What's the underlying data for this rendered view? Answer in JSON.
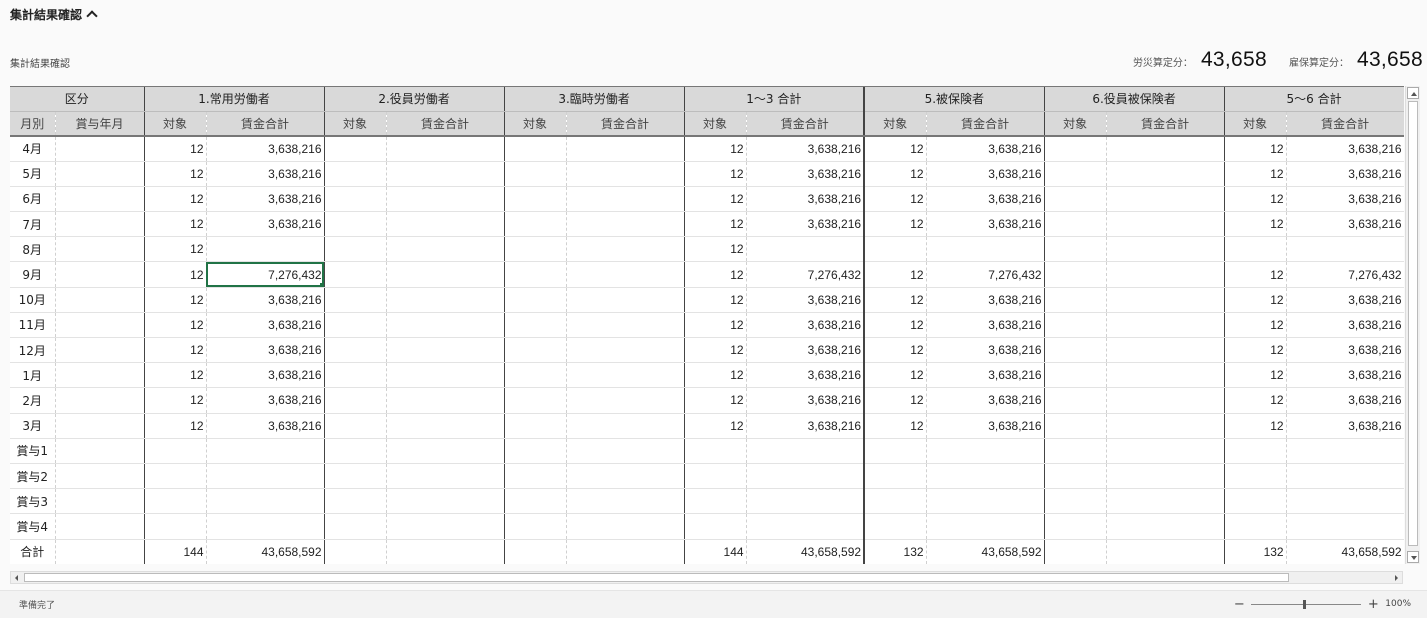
{
  "section": {
    "title": "集計結果確認"
  },
  "sub_title": "集計結果確認",
  "summary": {
    "rousai_label": "労災算定分：",
    "rousai_value": "43,658",
    "koyou_label": "雇保算定分：",
    "koyou_value": "43,658"
  },
  "grid": {
    "groups": [
      "区分",
      "1.常用労働者",
      "2.役員労働者",
      "3.臨時労働者",
      "1〜3 合計",
      "5.被保険者",
      "6.役員被保険者",
      "5〜6 合計"
    ],
    "sub_headers": [
      "月別",
      "賞与年月",
      "対象",
      "賃金合計",
      "対象",
      "賃金合計",
      "対象",
      "賃金合計",
      "対象",
      "賃金合計",
      "対象",
      "賃金合計",
      "対象",
      "賃金合計",
      "対象",
      "賃金合計"
    ],
    "rows": [
      [
        "4月",
        "",
        "12",
        "3,638,216",
        "",
        "",
        "",
        "",
        "12",
        "3,638,216",
        "12",
        "3,638,216",
        "",
        "",
        "12",
        "3,638,216"
      ],
      [
        "5月",
        "",
        "12",
        "3,638,216",
        "",
        "",
        "",
        "",
        "12",
        "3,638,216",
        "12",
        "3,638,216",
        "",
        "",
        "12",
        "3,638,216"
      ],
      [
        "6月",
        "",
        "12",
        "3,638,216",
        "",
        "",
        "",
        "",
        "12",
        "3,638,216",
        "12",
        "3,638,216",
        "",
        "",
        "12",
        "3,638,216"
      ],
      [
        "7月",
        "",
        "12",
        "3,638,216",
        "",
        "",
        "",
        "",
        "12",
        "3,638,216",
        "12",
        "3,638,216",
        "",
        "",
        "12",
        "3,638,216"
      ],
      [
        "8月",
        "",
        "12",
        "",
        "",
        "",
        "",
        "",
        "12",
        "",
        "",
        "",
        "",
        "",
        "",
        ""
      ],
      [
        "9月",
        "",
        "12",
        "7,276,432",
        "",
        "",
        "",
        "",
        "12",
        "7,276,432",
        "12",
        "7,276,432",
        "",
        "",
        "12",
        "7,276,432"
      ],
      [
        "10月",
        "",
        "12",
        "3,638,216",
        "",
        "",
        "",
        "",
        "12",
        "3,638,216",
        "12",
        "3,638,216",
        "",
        "",
        "12",
        "3,638,216"
      ],
      [
        "11月",
        "",
        "12",
        "3,638,216",
        "",
        "",
        "",
        "",
        "12",
        "3,638,216",
        "12",
        "3,638,216",
        "",
        "",
        "12",
        "3,638,216"
      ],
      [
        "12月",
        "",
        "12",
        "3,638,216",
        "",
        "",
        "",
        "",
        "12",
        "3,638,216",
        "12",
        "3,638,216",
        "",
        "",
        "12",
        "3,638,216"
      ],
      [
        "1月",
        "",
        "12",
        "3,638,216",
        "",
        "",
        "",
        "",
        "12",
        "3,638,216",
        "12",
        "3,638,216",
        "",
        "",
        "12",
        "3,638,216"
      ],
      [
        "2月",
        "",
        "12",
        "3,638,216",
        "",
        "",
        "",
        "",
        "12",
        "3,638,216",
        "12",
        "3,638,216",
        "",
        "",
        "12",
        "3,638,216"
      ],
      [
        "3月",
        "",
        "12",
        "3,638,216",
        "",
        "",
        "",
        "",
        "12",
        "3,638,216",
        "12",
        "3,638,216",
        "",
        "",
        "12",
        "3,638,216"
      ],
      [
        "賞与1",
        "",
        "",
        "",
        "",
        "",
        "",
        "",
        "",
        "",
        "",
        "",
        "",
        "",
        "",
        ""
      ],
      [
        "賞与2",
        "",
        "",
        "",
        "",
        "",
        "",
        "",
        "",
        "",
        "",
        "",
        "",
        "",
        "",
        ""
      ],
      [
        "賞与3",
        "",
        "",
        "",
        "",
        "",
        "",
        "",
        "",
        "",
        "",
        "",
        "",
        "",
        "",
        ""
      ],
      [
        "賞与4",
        "",
        "",
        "",
        "",
        "",
        "",
        "",
        "",
        "",
        "",
        "",
        "",
        "",
        "",
        ""
      ],
      [
        "合計",
        "",
        "144",
        "43,658,592",
        "",
        "",
        "",
        "",
        "144",
        "43,658,592",
        "132",
        "43,658,592",
        "",
        "",
        "132",
        "43,658,592"
      ]
    ],
    "selected": {
      "row": 5,
      "col": 3
    }
  },
  "status": {
    "ready": "準備完了",
    "zoom_minus": "−",
    "zoom_plus": "+",
    "zoom_pct": "100%",
    "zoom_level": 1.0
  }
}
